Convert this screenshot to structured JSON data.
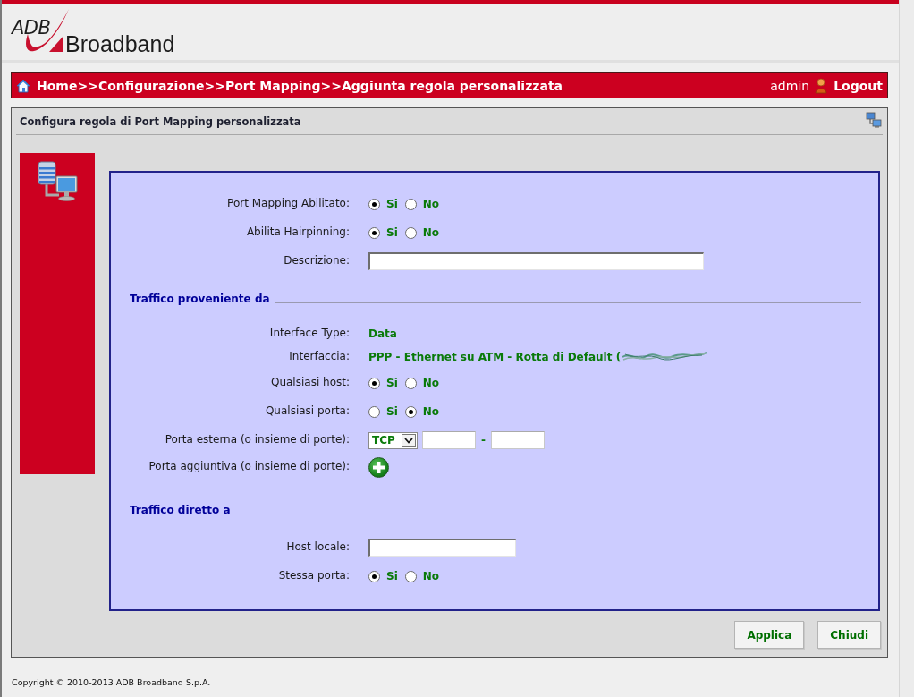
{
  "page_header": {
    "logo_top": "ADB",
    "logo_bottom": "Broadband"
  },
  "breadcrumb": {
    "crumbs": [
      {
        "text": "Home",
        "separator": ">>"
      },
      {
        "text": "Configurazione",
        "separator": ">>"
      },
      {
        "text": "Port Mapping",
        "separator": ">>"
      },
      {
        "text": "Aggiunta regola personalizzata"
      }
    ],
    "user": "admin",
    "logout": "Logout"
  },
  "panel": {
    "title": "Configura regola di Port Mapping personalizzata"
  },
  "form": {
    "rows": [
      {
        "kind": "radio",
        "label": "Port Mapping Abilitato:",
        "options": [
          {
            "label": "Si",
            "selected": true
          },
          {
            "label": "No",
            "selected": false
          }
        ]
      },
      {
        "kind": "radio",
        "label": "Abilita Hairpinning:",
        "options": [
          {
            "label": "Si",
            "selected": true
          },
          {
            "label": "No",
            "selected": false
          }
        ]
      },
      {
        "kind": "text",
        "label": "Descrizione:"
      },
      {
        "kind": "section",
        "title": "Traffico proveniente da"
      },
      {
        "kind": "value",
        "label": "Interface Type:",
        "value": "Data",
        "redacted": false
      },
      {
        "kind": "value",
        "label": "Interfaccia:",
        "value": "PPP - Ethernet su ATM - Rotta di Default (",
        "redacted": true
      },
      {
        "kind": "radio",
        "label": "Qualsiasi host:",
        "options": [
          {
            "label": "Si",
            "selected": true
          },
          {
            "label": "No",
            "selected": false
          }
        ]
      },
      {
        "kind": "radio",
        "label": "Qualsiasi porta:",
        "options": [
          {
            "label": "Si",
            "selected": false
          },
          {
            "label": "No",
            "selected": true
          }
        ]
      },
      {
        "kind": "portrange",
        "label": "Porta esterna (o insieme di porte):",
        "protocol": "TCP",
        "separator": "-"
      },
      {
        "kind": "add",
        "label": "Porta aggiuntiva (o insieme di porte):"
      },
      {
        "kind": "section",
        "title": "Traffico diretto a"
      },
      {
        "kind": "address",
        "label": "Host locale:"
      },
      {
        "kind": "radio",
        "label": "Stessa porta:",
        "options": [
          {
            "label": "Si",
            "selected": true
          },
          {
            "label": "No",
            "selected": false
          }
        ]
      }
    ]
  },
  "buttons": [
    {
      "label": "Applica"
    },
    {
      "label": "Chiudi"
    }
  ],
  "footer": "Copyright © 2010-2013 ADB Broadband S.p.A."
}
